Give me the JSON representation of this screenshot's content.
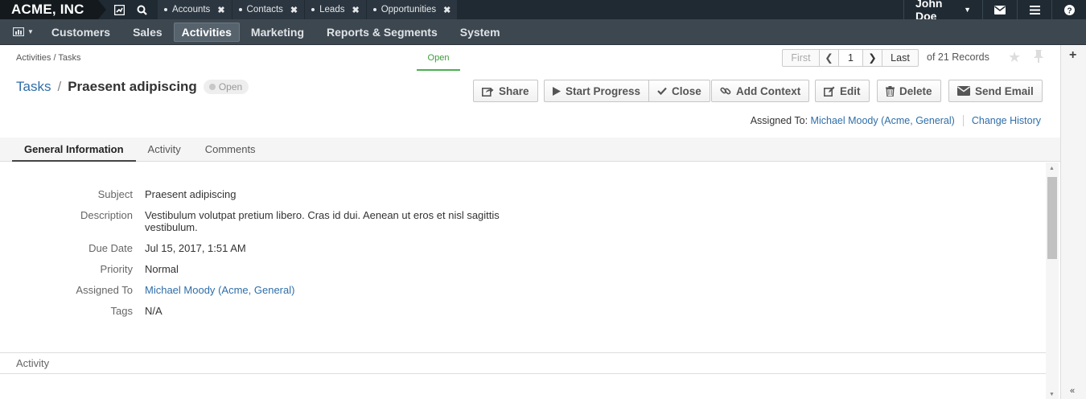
{
  "topbar": {
    "brand": "ACME, INC",
    "tabs": [
      {
        "label": "Accounts"
      },
      {
        "label": "Contacts"
      },
      {
        "label": "Leads"
      },
      {
        "label": "Opportunities"
      }
    ],
    "user": "John Doe"
  },
  "menu": {
    "items": [
      "Customers",
      "Sales",
      "Activities",
      "Marketing",
      "Reports & Segments",
      "System"
    ],
    "active": "Activities"
  },
  "breadcrumb": "Activities / Tasks",
  "status_step": "Open",
  "pager": {
    "first": "First",
    "page": "1",
    "last": "Last",
    "records": "of 21 Records"
  },
  "record": {
    "module": "Tasks",
    "title": "Praesent adipiscing",
    "status": "Open"
  },
  "actions": {
    "share": "Share",
    "start_progress": "Start Progress",
    "close": "Close",
    "add_context": "Add Context",
    "edit": "Edit",
    "delete": "Delete",
    "send_email": "Send Email"
  },
  "assigned": {
    "label": "Assigned To:",
    "user": "Michael Moody",
    "org1": "Acme",
    "org2": "General",
    "change_history": "Change History"
  },
  "tabs": [
    "General Information",
    "Activity",
    "Comments"
  ],
  "fields": {
    "subject_label": "Subject",
    "subject": "Praesent adipiscing",
    "description_label": "Description",
    "description": "Vestibulum volutpat pretium libero. Cras id dui. Aenean ut eros et nisl sagittis vestibulum.",
    "due_label": "Due Date",
    "due": "Jul 15, 2017, 1:51 AM",
    "priority_label": "Priority",
    "priority": "Normal",
    "assigned_label": "Assigned To",
    "assigned_user": "Michael Moody",
    "assigned_org1": "Acme",
    "assigned_org2": "General",
    "tags_label": "Tags",
    "tags": "N/A"
  },
  "section_activity": "Activity"
}
